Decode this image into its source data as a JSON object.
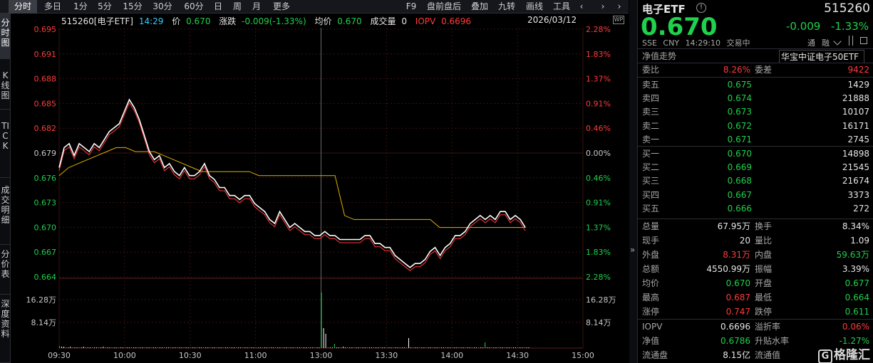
{
  "toolbar": {
    "tabs": [
      "分时",
      "多日",
      "1分",
      "5分",
      "15分",
      "30分",
      "60分",
      "日",
      "周",
      "月",
      "更多"
    ],
    "active": "分时",
    "right": [
      "F9",
      "盘前盘后",
      "叠加",
      "九转",
      "画线",
      "工具"
    ]
  },
  "lefttabs": [
    "分时图",
    "K线图",
    "TICK",
    "成交明细",
    "分价表",
    "深度资料"
  ],
  "header": {
    "code_name": "515260[电子ETF]",
    "time": "14:29",
    "price_label": "价",
    "price": "0.670",
    "change_label": "涨跌",
    "change": "-0.009(-1.33%)",
    "avg_label": "均价",
    "avg": "0.670",
    "vol_label": "成交量",
    "vol": "0",
    "iopv_label": "IOPV",
    "iopv": "0.6696",
    "date": "2026/03/12"
  },
  "axis": {
    "left": [
      "0.695",
      "0.691",
      "0.688",
      "0.685",
      "0.682",
      "0.679",
      "0.676",
      "0.673",
      "0.670",
      "0.667",
      "0.664"
    ],
    "right": [
      "2.28%",
      "1.83%",
      "1.37%",
      "0.91%",
      "0.46%",
      "0.00%",
      "0.46%",
      "0.91%",
      "1.37%",
      "1.83%",
      "2.28%"
    ],
    "vol_left": [
      "16.28万",
      "8.14万"
    ],
    "vol_right": [
      "16.28万",
      "8.14万"
    ],
    "x": [
      "09:30",
      "10:00",
      "10:30",
      "11:00",
      "13:00",
      "13:30",
      "14:00",
      "14:30",
      "15:00"
    ]
  },
  "colors": {
    "up": "#ff3b3b",
    "down": "#1fd14c",
    "price": "#ffffff",
    "avg": "#e0b000",
    "iopv": "#ff3b3b",
    "grid": "#3a1414"
  },
  "chart_data": {
    "type": "line",
    "series": [
      {
        "name": "价",
        "values": [
          0.6775,
          0.68,
          0.6805,
          0.679,
          0.6805,
          0.68,
          0.6795,
          0.6805,
          0.68,
          0.681,
          0.682,
          0.6825,
          0.683,
          0.6845,
          0.686,
          0.685,
          0.6835,
          0.6815,
          0.6795,
          0.6785,
          0.679,
          0.6775,
          0.678,
          0.677,
          0.6765,
          0.6775,
          0.6765,
          0.6765,
          0.677,
          0.678,
          0.6765,
          0.676,
          0.675,
          0.675,
          0.674,
          0.674,
          0.6735,
          0.674,
          0.674,
          0.673,
          0.6725,
          0.672,
          0.671,
          0.6705,
          0.672,
          0.671,
          0.67,
          0.6705,
          0.67,
          0.6695,
          0.6695,
          0.669,
          0.669,
          0.6695,
          0.669,
          0.669,
          0.6685,
          0.6685,
          0.6685,
          0.6685,
          0.6685,
          0.669,
          0.669,
          0.668,
          0.668,
          0.6675,
          0.6675,
          0.6665,
          0.666,
          0.6655,
          0.665,
          0.6655,
          0.6655,
          0.666,
          0.667,
          0.6675,
          0.6665,
          0.6675,
          0.668,
          0.669,
          0.669,
          0.6695,
          0.6705,
          0.671,
          0.6715,
          0.671,
          0.6715,
          0.671,
          0.672,
          0.672,
          0.671,
          0.6715,
          0.671,
          0.67
        ]
      },
      {
        "name": "均价",
        "values": [
          0.6765,
          0.6775,
          0.678,
          0.6785,
          0.679,
          0.6795,
          0.68,
          0.68,
          0.6795,
          0.6795,
          0.6795,
          0.679,
          0.6785,
          0.678,
          0.6775,
          0.677,
          0.677,
          0.677,
          0.677,
          0.677,
          0.677,
          0.6765,
          0.6765,
          0.6765,
          0.6765,
          0.6765,
          0.6765,
          0.6765,
          0.6765,
          0.6765,
          0.6715,
          0.671,
          0.671,
          0.671,
          0.671,
          0.671,
          0.671,
          0.671,
          0.671,
          0.671,
          0.67,
          0.67,
          0.67,
          0.67,
          0.67,
          0.67,
          0.67,
          0.67,
          0.67,
          0.67
        ]
      }
    ],
    "ylim": [
      0.664,
      0.695
    ]
  },
  "panel": {
    "name": "电子ETF",
    "code": "515260",
    "price": "0.670",
    "change": "-0.009",
    "pct": "-1.33%",
    "meta": [
      "SSE",
      "CNY",
      "14:29:10",
      "交易中"
    ],
    "badges": [
      "通",
      "融"
    ],
    "nav_trend": "净值走势",
    "tracking": "华宝中证电子50ETF",
    "weibi_label": "委比",
    "weibi": "8.26%",
    "weicha_label": "委差",
    "weicha": "9422",
    "asks": [
      {
        "label": "卖五",
        "price": "0.675",
        "vol": "1429"
      },
      {
        "label": "卖四",
        "price": "0.674",
        "vol": "21888"
      },
      {
        "label": "卖三",
        "price": "0.673",
        "vol": "10107"
      },
      {
        "label": "卖二",
        "price": "0.672",
        "vol": "16171"
      },
      {
        "label": "卖一",
        "price": "0.671",
        "vol": "2745"
      }
    ],
    "bids": [
      {
        "label": "买一",
        "price": "0.670",
        "vol": "14898"
      },
      {
        "label": "买二",
        "price": "0.669",
        "vol": "21545"
      },
      {
        "label": "买三",
        "price": "0.668",
        "vol": "21674"
      },
      {
        "label": "买四",
        "price": "0.667",
        "vol": "3373"
      },
      {
        "label": "买五",
        "price": "0.666",
        "vol": "272"
      }
    ],
    "stats": [
      {
        "l1": "总量",
        "v1": "67.95万",
        "c1": "white",
        "l2": "换手",
        "v2": "8.34%",
        "c2": "white"
      },
      {
        "l1": "现手",
        "v1": "20",
        "c1": "white",
        "l2": "量比",
        "v2": "1.09",
        "c2": "white"
      },
      {
        "l1": "外盘",
        "v1": "8.31万",
        "c1": "red",
        "l2": "内盘",
        "v2": "59.63万",
        "c2": "green"
      },
      {
        "l1": "总额",
        "v1": "4550.99万",
        "c1": "white",
        "l2": "振幅",
        "v2": "3.39%",
        "c2": "white"
      },
      {
        "l1": "均价",
        "v1": "0.670",
        "c1": "green",
        "l2": "开盘",
        "v2": "0.677",
        "c2": "green"
      },
      {
        "l1": "最高",
        "v1": "0.687",
        "c1": "red",
        "l2": "最低",
        "v2": "0.664",
        "c2": "green"
      },
      {
        "l1": "涨停",
        "v1": "0.747",
        "c1": "red",
        "l2": "跌停",
        "v2": "0.611",
        "c2": "green"
      }
    ],
    "extra": [
      {
        "l1": "IOPV",
        "v1": "0.6696",
        "c1": "white",
        "l2": "溢折率",
        "v2": "0.06%",
        "c2": "red"
      },
      {
        "l1": "净值",
        "v1": "0.6786",
        "c1": "green",
        "l2": "升贴水率",
        "v2": "-1.27%",
        "c2": "green"
      },
      {
        "l1": "流通盘",
        "v1": "8.15亿",
        "c1": "white",
        "l2": "流通值",
        "v2": "",
        "c2": "white"
      }
    ],
    "watermark": "格隆汇"
  }
}
